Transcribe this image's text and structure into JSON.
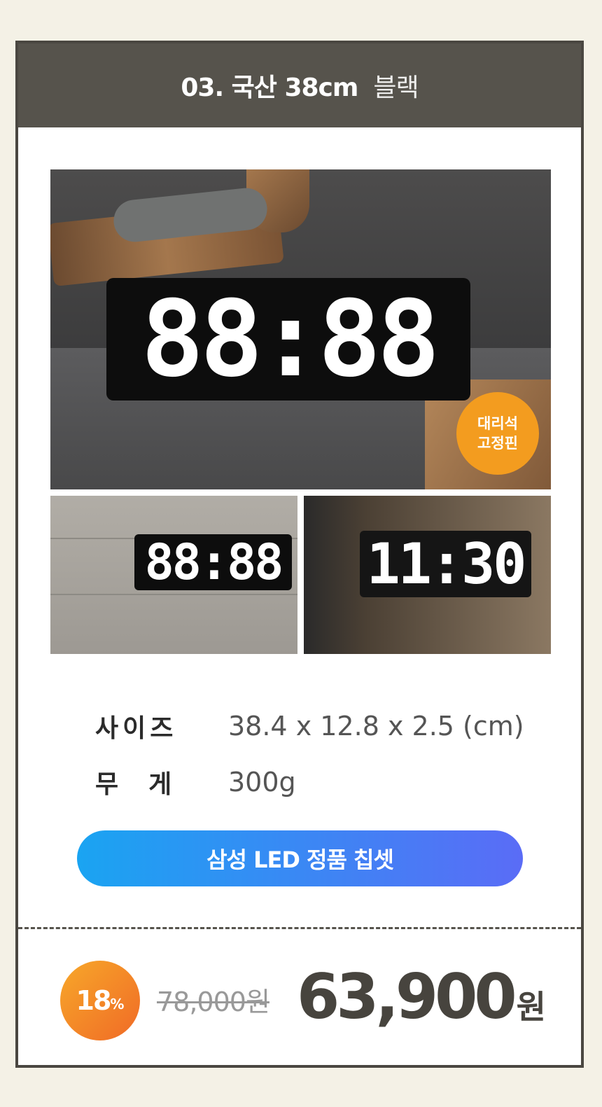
{
  "header": {
    "title_main": "03. 국산 38cm",
    "title_sub": "블랙"
  },
  "main_photo": {
    "clock_display": "88:88",
    "badge_line1": "대리석",
    "badge_line2": "고정핀"
  },
  "small_photos": [
    {
      "clock_display": "88:88"
    },
    {
      "clock_display": "11:30"
    }
  ],
  "specs": [
    {
      "label": "사이즈",
      "value": "38.4 x 12.8 x 2.5 (cm)"
    },
    {
      "label": "무  게",
      "value": "300g"
    }
  ],
  "chip_button": {
    "label": "삼성 LED 정품 칩셋"
  },
  "pricing": {
    "discount": "18",
    "discount_unit": "%",
    "original_price": "78,000원",
    "sale_price": "63,900",
    "sale_unit": "원"
  }
}
